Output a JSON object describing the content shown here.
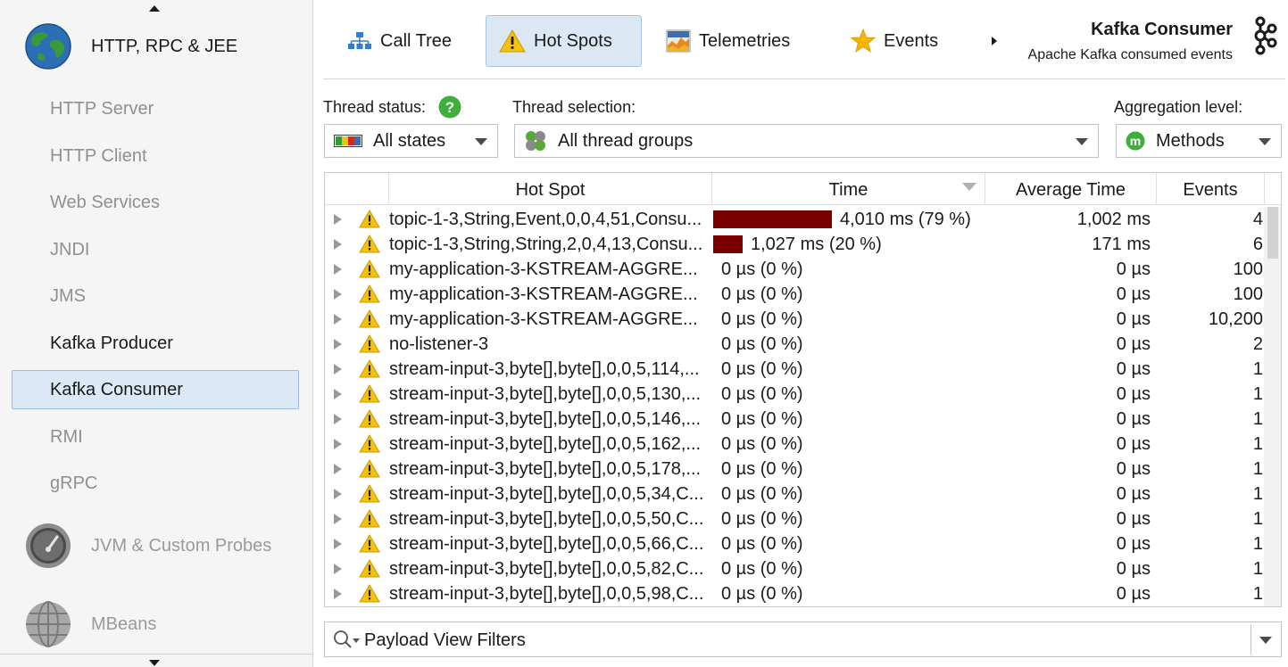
{
  "sidebar": {
    "sections": [
      {
        "label": "HTTP, RPC & JEE",
        "icon": "globe-icon"
      },
      {
        "label": "JVM & Custom Probes",
        "icon": "gauge-icon"
      },
      {
        "label": "MBeans",
        "icon": "mbeans-globe-icon"
      }
    ],
    "items": [
      {
        "label": "HTTP Server",
        "active": false
      },
      {
        "label": "HTTP Client",
        "active": false
      },
      {
        "label": "Web Services",
        "active": false
      },
      {
        "label": "JNDI",
        "active": false
      },
      {
        "label": "JMS",
        "active": false
      },
      {
        "label": "Kafka Producer",
        "active": true
      },
      {
        "label": "Kafka Consumer",
        "active": true,
        "selected": true
      },
      {
        "label": "RMI",
        "active": false
      },
      {
        "label": "gRPC",
        "active": false
      }
    ]
  },
  "tabs": [
    {
      "label": "Call Tree",
      "icon": "call-tree-icon",
      "selected": false
    },
    {
      "label": "Hot Spots",
      "icon": "warning-icon",
      "selected": true
    },
    {
      "label": "Telemetries",
      "icon": "telemetry-icon",
      "selected": false
    },
    {
      "label": "Events",
      "icon": "star-icon",
      "selected": false
    }
  ],
  "header": {
    "title": "Kafka Consumer",
    "subtitle": "Apache Kafka consumed events",
    "logo_icon": "kafka-logo-icon"
  },
  "controls": {
    "thread_status": {
      "label": "Thread status:",
      "value": "All states"
    },
    "thread_selection": {
      "label": "Thread selection:",
      "value": "All thread groups"
    },
    "aggregation": {
      "label": "Aggregation level:",
      "value": "Methods"
    }
  },
  "table": {
    "columns": [
      "Hot Spot",
      "Time",
      "Average Time",
      "Events"
    ],
    "sort_column": "Time",
    "accent_bar_color": "#7a0000",
    "rows": [
      {
        "name": "topic-1-3,String,Event,0,0,4,51,Consu...",
        "time": "4,010 ms (79 %)",
        "pct": 79,
        "avg": "1,002 ms",
        "events": "4"
      },
      {
        "name": "topic-1-3,String,String,2,0,4,13,Consu...",
        "time": "1,027 ms (20 %)",
        "pct": 20,
        "avg": "171 ms",
        "events": "6"
      },
      {
        "name": "my-application-3-KSTREAM-AGGRE...",
        "time": "0 µs (0 %)",
        "pct": 0,
        "avg": "0 µs",
        "events": "100"
      },
      {
        "name": "my-application-3-KSTREAM-AGGRE...",
        "time": "0 µs (0 %)",
        "pct": 0,
        "avg": "0 µs",
        "events": "100"
      },
      {
        "name": "my-application-3-KSTREAM-AGGRE...",
        "time": "0 µs (0 %)",
        "pct": 0,
        "avg": "0 µs",
        "events": "10,200"
      },
      {
        "name": "no-listener-3",
        "time": "0 µs (0 %)",
        "pct": 0,
        "avg": "0 µs",
        "events": "2"
      },
      {
        "name": "stream-input-3,byte[],byte[],0,0,5,114,...",
        "time": "0 µs (0 %)",
        "pct": 0,
        "avg": "0 µs",
        "events": "1"
      },
      {
        "name": "stream-input-3,byte[],byte[],0,0,5,130,...",
        "time": "0 µs (0 %)",
        "pct": 0,
        "avg": "0 µs",
        "events": "1"
      },
      {
        "name": "stream-input-3,byte[],byte[],0,0,5,146,...",
        "time": "0 µs (0 %)",
        "pct": 0,
        "avg": "0 µs",
        "events": "1"
      },
      {
        "name": "stream-input-3,byte[],byte[],0,0,5,162,...",
        "time": "0 µs (0 %)",
        "pct": 0,
        "avg": "0 µs",
        "events": "1"
      },
      {
        "name": "stream-input-3,byte[],byte[],0,0,5,178,...",
        "time": "0 µs (0 %)",
        "pct": 0,
        "avg": "0 µs",
        "events": "1"
      },
      {
        "name": "stream-input-3,byte[],byte[],0,0,5,34,C...",
        "time": "0 µs (0 %)",
        "pct": 0,
        "avg": "0 µs",
        "events": "1"
      },
      {
        "name": "stream-input-3,byte[],byte[],0,0,5,50,C...",
        "time": "0 µs (0 %)",
        "pct": 0,
        "avg": "0 µs",
        "events": "1"
      },
      {
        "name": "stream-input-3,byte[],byte[],0,0,5,66,C...",
        "time": "0 µs (0 %)",
        "pct": 0,
        "avg": "0 µs",
        "events": "1"
      },
      {
        "name": "stream-input-3,byte[],byte[],0,0,5,82,C...",
        "time": "0 µs (0 %)",
        "pct": 0,
        "avg": "0 µs",
        "events": "1"
      },
      {
        "name": "stream-input-3,byte[],byte[],0,0,5,98,C...",
        "time": "0 µs (0 %)",
        "pct": 0,
        "avg": "0 µs",
        "events": "1"
      }
    ]
  },
  "filter": {
    "label": "Payload View Filters"
  }
}
